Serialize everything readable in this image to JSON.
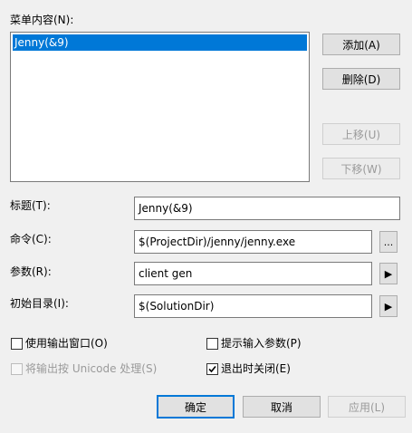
{
  "menu": {
    "label": "菜单内容(N):",
    "items": [
      {
        "label": "Jenny(&9)"
      }
    ]
  },
  "buttons": {
    "add": "添加(A)",
    "delete": "删除(D)",
    "move_up": "上移(U)",
    "move_down": "下移(W)"
  },
  "fields": {
    "title_label": "标题(T):",
    "title_value": "Jenny(&9)",
    "command_label": "命令(C):",
    "command_value": "$(ProjectDir)/jenny/jenny.exe",
    "args_label": "参数(R):",
    "args_value": "client gen",
    "initdir_label": "初始目录(I):",
    "initdir_value": "$(SolutionDir)"
  },
  "glyphs": {
    "ellipsis": "...",
    "arrow": "▶"
  },
  "options": {
    "use_output_window": {
      "label": "使用输出窗口(O)",
      "checked": false,
      "enabled": true
    },
    "prompt_args": {
      "label": "提示输入参数(P)",
      "checked": false,
      "enabled": true
    },
    "unicode_output": {
      "label": "将输出按 Unicode 处理(S)",
      "checked": false,
      "enabled": false
    },
    "close_on_exit": {
      "label": "退出时关闭(E)",
      "checked": true,
      "enabled": true
    }
  },
  "footer": {
    "ok": "确定",
    "cancel": "取消",
    "apply": "应用(L)"
  }
}
